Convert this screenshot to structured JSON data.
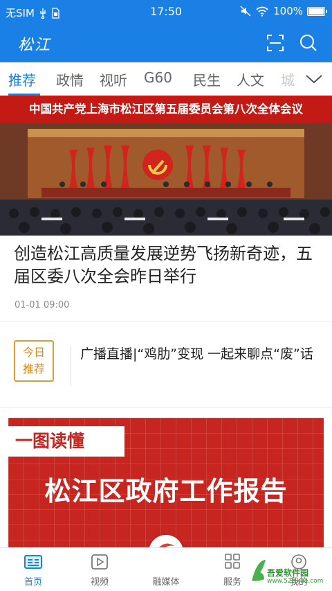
{
  "status_bar": {
    "carrier": "无SIM",
    "time": "17:50",
    "battery": "100%"
  },
  "app_bar": {
    "logo_text": "松江",
    "icons": [
      "scan-icon",
      "search-icon"
    ]
  },
  "tabs": [
    {
      "label": "推荐",
      "active": true
    },
    {
      "label": "政情",
      "active": false
    },
    {
      "label": "视听",
      "active": false
    },
    {
      "label": "G60",
      "active": false
    },
    {
      "label": "民生",
      "active": false
    },
    {
      "label": "人文",
      "active": false
    },
    {
      "label": "城",
      "active": false
    }
  ],
  "hero": {
    "banner": "中国共产党上海市松江区第五届委员会第八次全体会议"
  },
  "headline": {
    "title": "创造松江高质量发展逆势飞扬新奇迹，五届区委八次全会昨日举行",
    "time": "01-01 09:00"
  },
  "recommend": {
    "badge_line1": "今日",
    "badge_line2": "推荐",
    "text": "广播直播|“鸡肋”变现  一起来聊点“废”话"
  },
  "poster": {
    "tag": "一图读懂",
    "title": "松江区政府工作报告"
  },
  "bottom_nav": [
    {
      "label": "首页",
      "icon": "home-icon",
      "active": true
    },
    {
      "label": "视频",
      "icon": "video-icon",
      "active": false
    },
    {
      "label": "融媒体",
      "icon": "media-logo-icon",
      "active": false
    },
    {
      "label": "服务",
      "icon": "grid-icon",
      "active": false
    },
    {
      "label": "我的",
      "icon": "profile-icon",
      "active": false
    }
  ],
  "watermark": {
    "name": "吾爱软件园",
    "url": "www.52zixue.com"
  },
  "colors": {
    "primary": "#1a80e6",
    "hero_red": "#c41a16",
    "badge_orange": "#e69a2a"
  }
}
